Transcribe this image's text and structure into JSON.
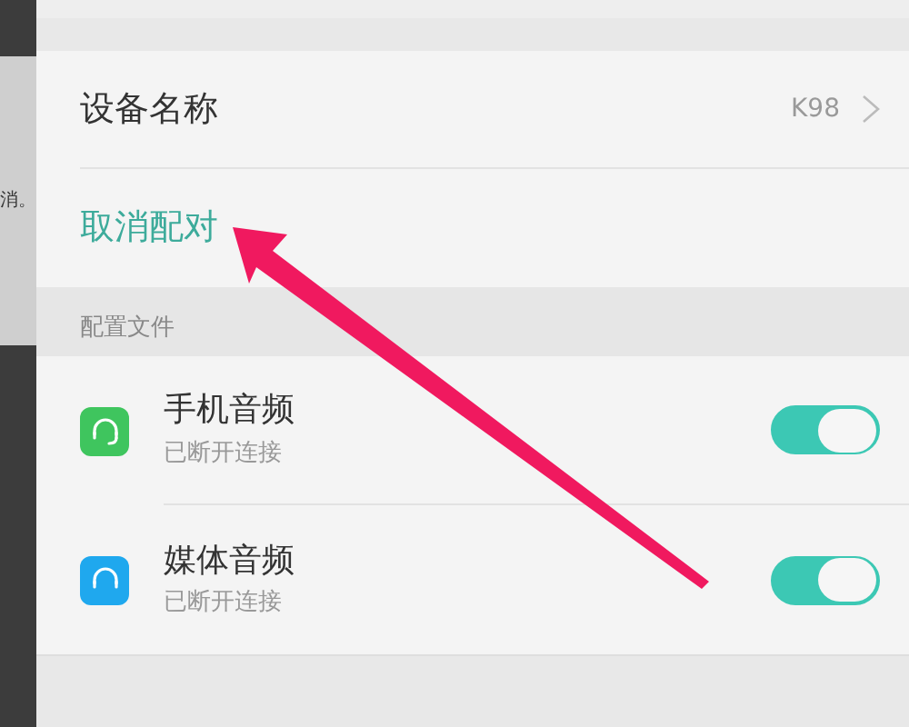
{
  "background_text": "消。",
  "device": {
    "label": "设备名称",
    "value": "K98"
  },
  "unpair": {
    "label": "取消配对"
  },
  "section": {
    "title": "配置文件"
  },
  "profiles": [
    {
      "kind": "call",
      "name": "手机音频",
      "status": "已断开连接",
      "on": true
    },
    {
      "kind": "media",
      "name": "媒体音频",
      "status": "已断开连接",
      "on": true
    }
  ]
}
